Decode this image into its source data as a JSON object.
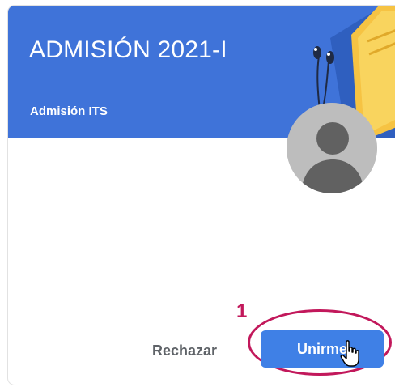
{
  "class_card": {
    "title": "ADMISIÓN 2021-I",
    "section": "Admisión ITS"
  },
  "annotation": {
    "step_number": "1"
  },
  "actions": {
    "decline_label": "Rechazar",
    "join_label": "Unirme"
  },
  "colors": {
    "header_blue": "#3f73d9",
    "join_button_blue": "#3f80e6",
    "annotation_magenta": "#c2185b",
    "book_yellow": "#f6c343",
    "avatar_gray": "#bdbdbd"
  },
  "icons": {
    "avatar": "person-silhouette-icon",
    "cursor": "hand-pointer-icon",
    "illustration": "headphones-and-book-icon"
  }
}
